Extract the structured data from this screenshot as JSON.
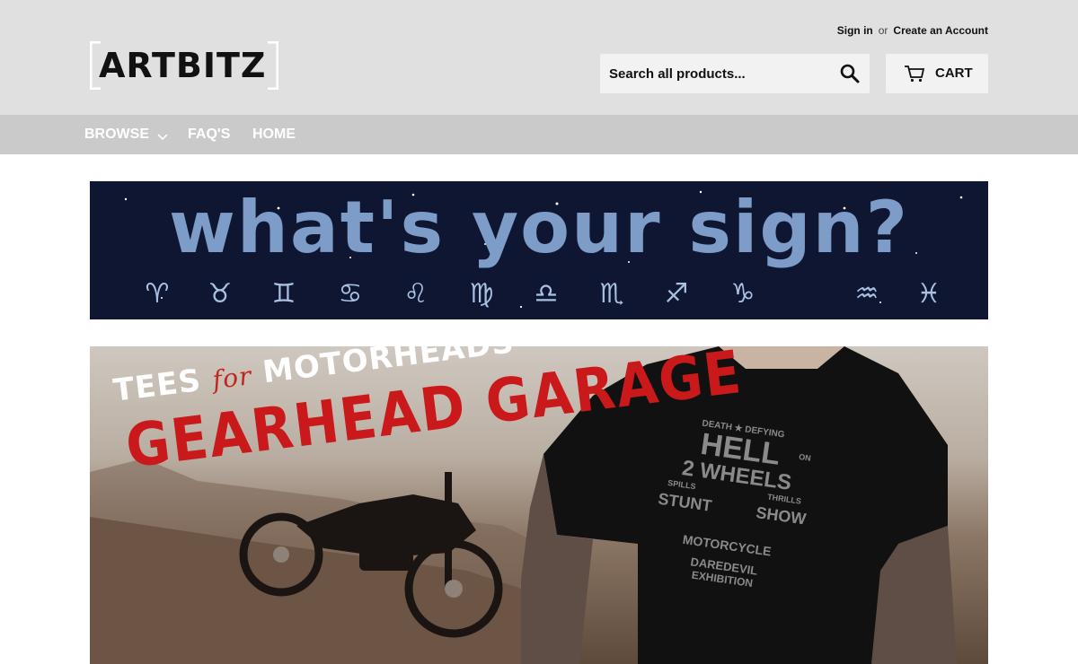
{
  "header": {
    "logo_text": "ARTBITZ",
    "sign_in": "Sign in",
    "or": "or",
    "create_account": "Create an Account",
    "search_placeholder": "Search all products...",
    "cart_label": "CART"
  },
  "nav": {
    "items": [
      {
        "label": "BROWSE"
      },
      {
        "label": "FAQ'S"
      },
      {
        "label": "HOME"
      }
    ]
  },
  "banner_zodiac": {
    "title": "What's your sign?",
    "signs": [
      "♈",
      "♉",
      "♊",
      "♋",
      "♌",
      "♍",
      "♎",
      "♏",
      "♐",
      "♑",
      "♒",
      "♓"
    ]
  },
  "banner_garage": {
    "subtitle_pre": "TEES",
    "subtitle_for": "for",
    "subtitle_post": "MOTORHEADS",
    "title": "GEARHEAD GARAGE",
    "shirt_lines": [
      "DEATH ★ DEFYING",
      "HELL",
      "ON",
      "2 WHEELS",
      "SPILLS",
      "THRILLS",
      "STUNT",
      "SHOW",
      "MOTORCYCLE",
      "DAREDEVIL",
      "EXHIBITION"
    ]
  },
  "colors": {
    "topbar": "#e0e0e0",
    "nav": "#cacaca",
    "banner_bg": "#0e1631",
    "accent_red": "#c9191a"
  }
}
